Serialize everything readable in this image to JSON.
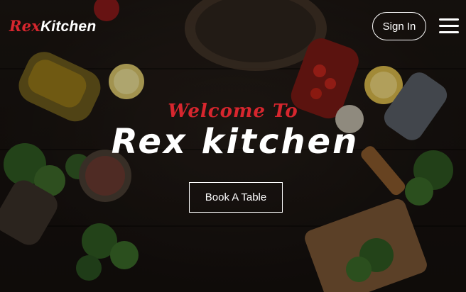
{
  "logo": {
    "part1": "Rex",
    "part2": "Kitchen"
  },
  "header": {
    "signin_label": "Sign In",
    "menu_icon": "hamburger-menu-icon"
  },
  "hero": {
    "welcome": "Welcome To",
    "title": "Rex kitchen",
    "cta_label": "Book A Table"
  },
  "colors": {
    "accent": "#d7262e",
    "text": "#ffffff"
  }
}
